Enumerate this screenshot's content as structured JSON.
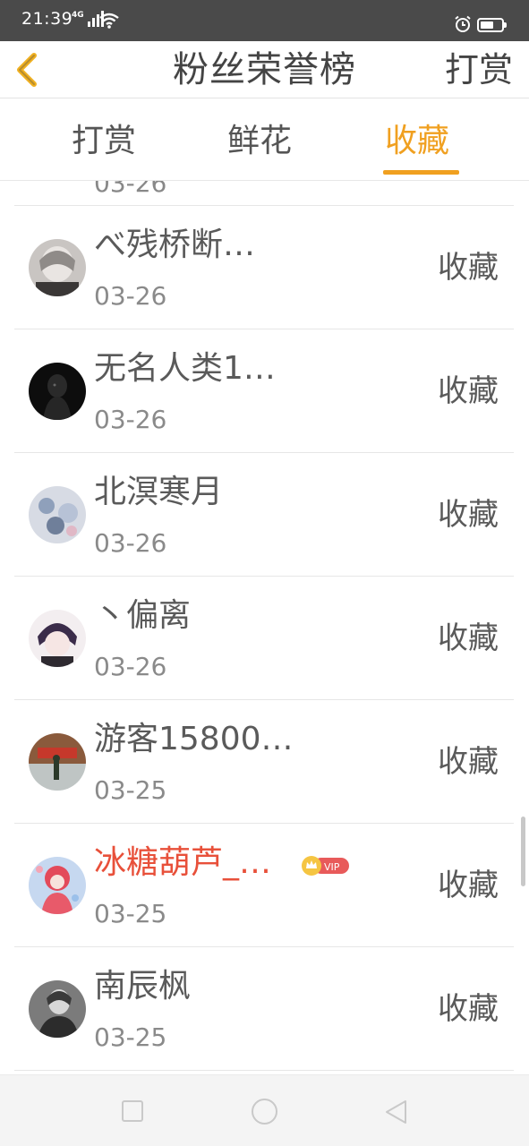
{
  "status_bar": {
    "time": "21:39",
    "network": "4G",
    "icons": [
      "signal-icon",
      "wifi-icon",
      "alarm-icon",
      "battery-icon"
    ]
  },
  "header": {
    "title": "粉丝荣誉榜",
    "right_action": "打赏",
    "back_icon": "chevron-left-icon"
  },
  "tabs": [
    {
      "label": "打赏",
      "active": false
    },
    {
      "label": "鲜花",
      "active": false
    },
    {
      "label": "收藏",
      "active": true
    }
  ],
  "list": {
    "partial_date": "03-26",
    "items": [
      {
        "name": "べ残桥断…",
        "date": "03-26",
        "action": "收藏",
        "vip": false
      },
      {
        "name": "无名人类1…",
        "date": "03-26",
        "action": "收藏",
        "vip": false
      },
      {
        "name": "北溟寒月",
        "date": "03-26",
        "action": "收藏",
        "vip": false
      },
      {
        "name": "丶偏离",
        "date": "03-26",
        "action": "收藏",
        "vip": false
      },
      {
        "name": "游客15800…",
        "date": "03-25",
        "action": "收藏",
        "vip": false
      },
      {
        "name": "冰糖葫芦_…",
        "date": "03-25",
        "action": "收藏",
        "vip": true,
        "badge": "VIP"
      },
      {
        "name": "南辰枫",
        "date": "03-25",
        "action": "收藏",
        "vip": false
      }
    ]
  },
  "colors": {
    "accent": "#f0a020",
    "vip_name": "#e8503a",
    "status_bar": "#4a4a4a"
  },
  "system_nav": [
    "recent-apps-icon",
    "home-icon",
    "back-triangle-icon"
  ]
}
